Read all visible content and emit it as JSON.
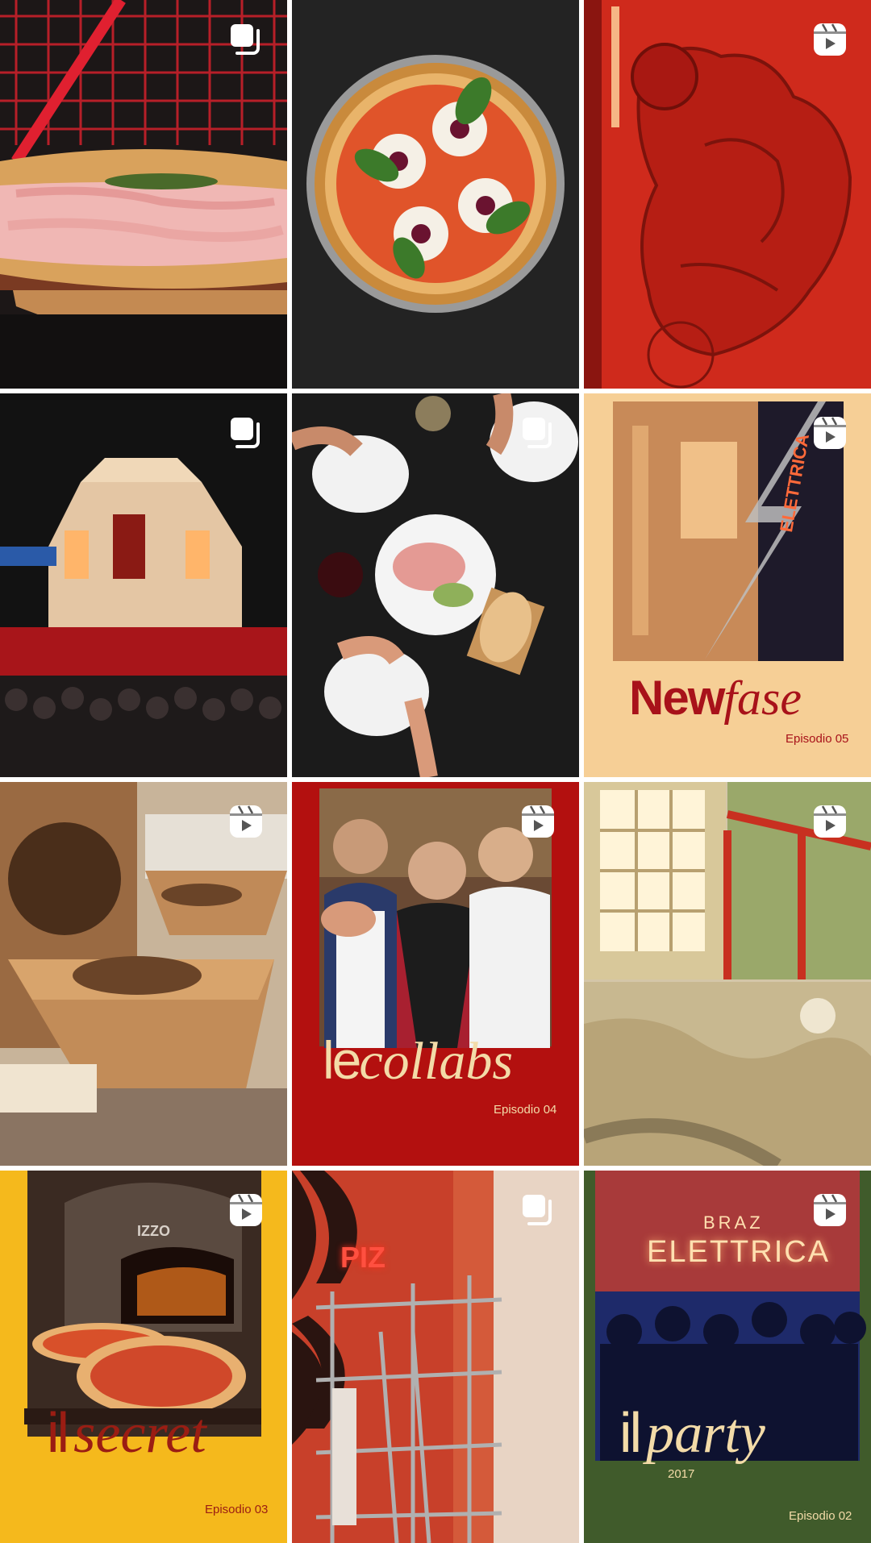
{
  "colors": {
    "page_bg": "#ffffff",
    "badge": "#ffffff",
    "title_red": "#a8121a",
    "title_cream": "#f3dba8",
    "title_dark_red": "#9b1d13"
  },
  "posts": [
    {
      "badge": "carousel-icon"
    },
    {
      "badge": ""
    },
    {
      "badge": "reel-icon"
    },
    {
      "badge": "carousel-icon"
    },
    {
      "badge": "carousel-icon"
    },
    {
      "badge": "reel-icon",
      "title_a": "New",
      "title_b": "fase",
      "episode": "Episodio 05",
      "sign_text": "ELETTRICA"
    },
    {
      "badge": "reel-icon"
    },
    {
      "badge": "reel-icon",
      "title_a": "le",
      "title_b": "collabs",
      "episode": "Episodio 04"
    },
    {
      "badge": "reel-icon"
    },
    {
      "badge": "reel-icon",
      "title_a": "il",
      "title_b": "secret",
      "episode": "Episodio 03",
      "oven_text": "IZZO"
    },
    {
      "badge": "carousel-icon",
      "neon_text": "PIZ"
    },
    {
      "badge": "reel-icon",
      "title_a": "il",
      "title_b": "party",
      "year": "2017",
      "episode": "Episodio 02",
      "sign_top": "BRAZ",
      "sign_main": "ELETTRICA"
    }
  ]
}
